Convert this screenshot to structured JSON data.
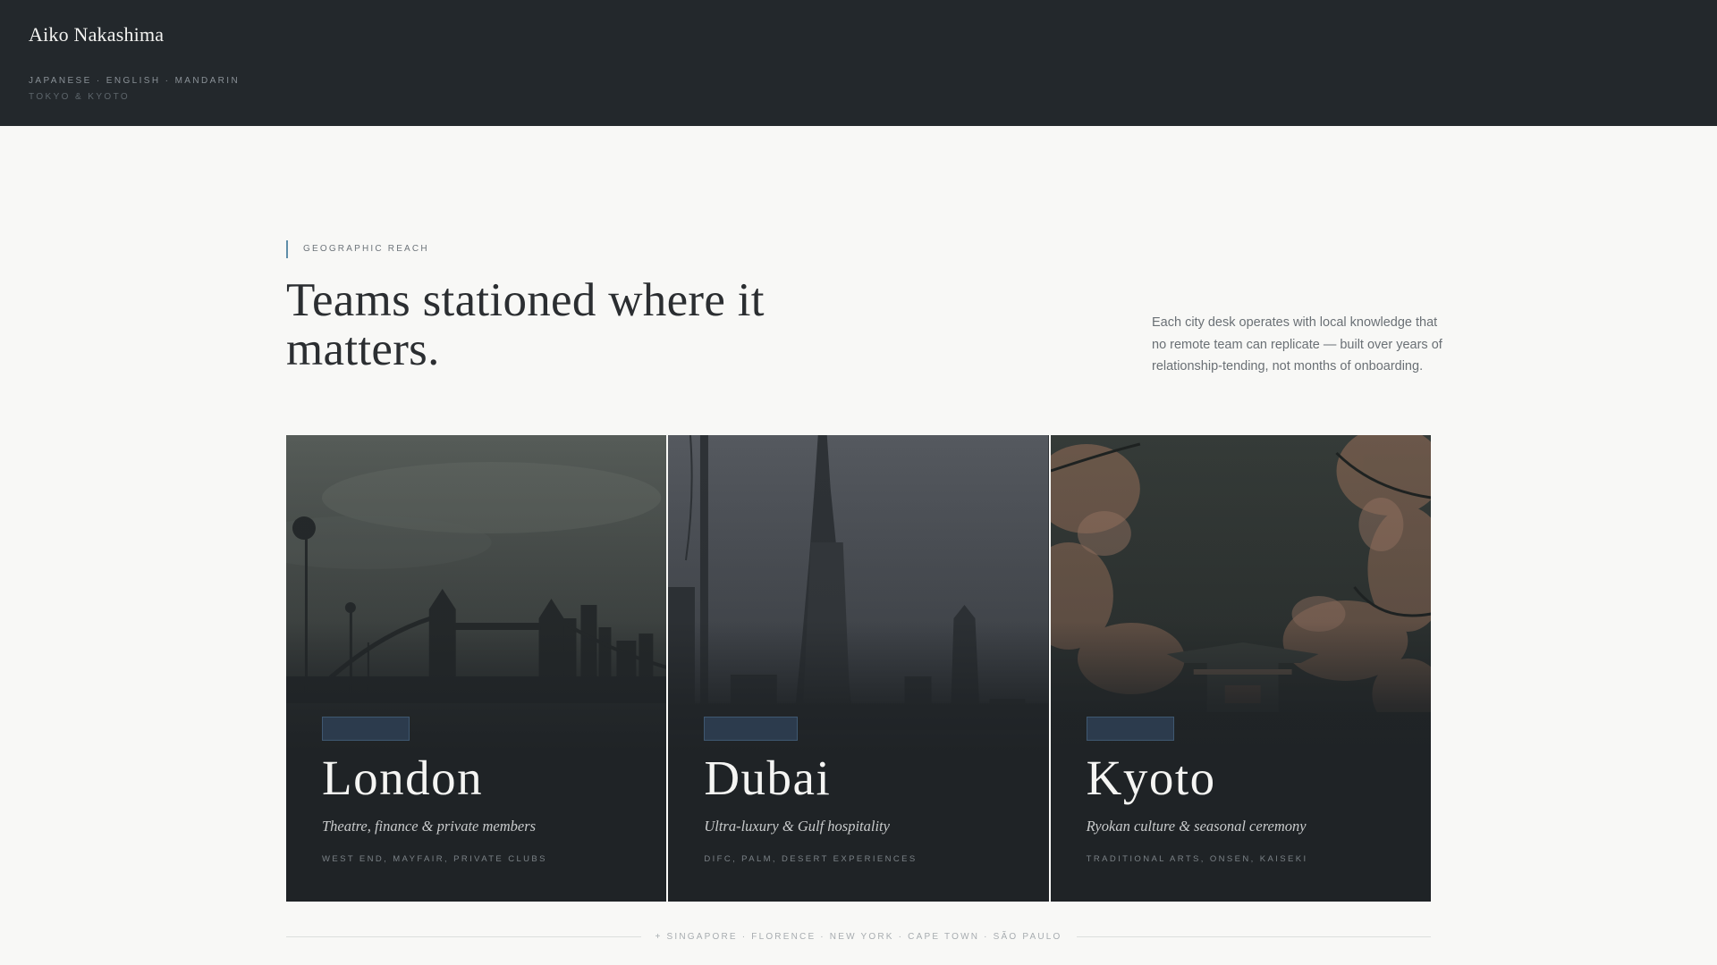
{
  "brand": {
    "name": "Aiko Nakashima",
    "subtitle": "",
    "languages": "Japanese · English · Mandarin",
    "base": "Tokyo & Kyoto"
  },
  "section": {
    "eyebrow": "Geographic Reach",
    "headline": "Teams stationed where it matters.",
    "intro": "Each city desk operates with local knowledge that no remote team can replicate — built over years of relationship-tending, not months of onboarding."
  },
  "cities": [
    {
      "city": "London",
      "focus": "Theatre, finance & private members",
      "areas": "West End, Mayfair, Private Clubs",
      "image": "london-tower-bridge-photo"
    },
    {
      "city": "Dubai",
      "focus": "Ultra-luxury & Gulf hospitality",
      "areas": "DIFC, Palm, Desert Experiences",
      "image": "dubai-burj-khalifa-photo"
    },
    {
      "city": "Kyoto",
      "focus": "Ryokan culture & seasonal ceremony",
      "areas": "Traditional Arts, Onsen, Kaiseki",
      "image": "kyoto-cherry-blossom-temple-photo"
    }
  ],
  "more_cities": "+ Singapore · Florence · New York · Cape Town · São Paulo",
  "colors": {
    "topbar": "#23282c",
    "page": "#f8f8f6",
    "accent": "#5f8ea9",
    "card": "#1f2326"
  }
}
